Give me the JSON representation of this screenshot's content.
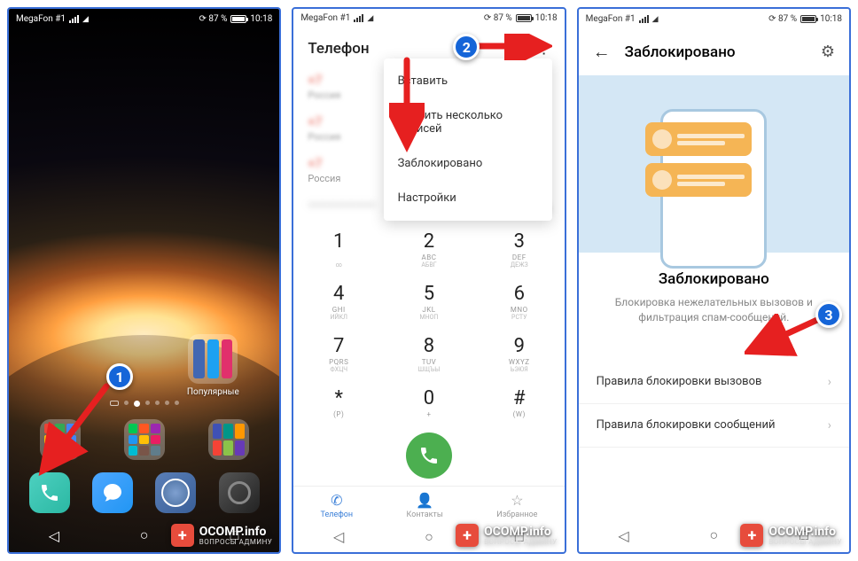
{
  "status": {
    "carrier": "MegaFon #1",
    "battery": "87 %",
    "time": "10:18"
  },
  "screen1": {
    "folder_label": "Популярные",
    "badge": "1"
  },
  "screen2": {
    "title": "Телефон",
    "badge": "2",
    "calls": [
      {
        "num": "+7",
        "sub": "Россия"
      },
      {
        "num": "+7",
        "sub": "Россия"
      },
      {
        "num": "+7",
        "sub": "Россия"
      }
    ],
    "recent_date": "02.07",
    "menu": [
      "Вставить",
      "Удалить несколько записей",
      "Заблокировано",
      "Настройки"
    ],
    "keys": [
      {
        "n": "1",
        "s1": "",
        "s2": "∞"
      },
      {
        "n": "2",
        "s1": "ABC",
        "s2": "АБВГ"
      },
      {
        "n": "3",
        "s1": "DEF",
        "s2": "ДЕЖЗ"
      },
      {
        "n": "4",
        "s1": "GHI",
        "s2": "ИЙКЛ"
      },
      {
        "n": "5",
        "s1": "JKL",
        "s2": "МНОП"
      },
      {
        "n": "6",
        "s1": "MNO",
        "s2": "РСТУ"
      },
      {
        "n": "7",
        "s1": "PQRS",
        "s2": "ФХЦЧ"
      },
      {
        "n": "8",
        "s1": "TUV",
        "s2": "ШЩЪЫ"
      },
      {
        "n": "9",
        "s1": "WXYZ",
        "s2": "ЬЭЮЯ"
      },
      {
        "n": "*",
        "s1": "(P)",
        "s2": ""
      },
      {
        "n": "0",
        "s1": "+",
        "s2": ""
      },
      {
        "n": "#",
        "s1": "(W)",
        "s2": ""
      }
    ],
    "tabs": {
      "phone": "Телефон",
      "contacts": "Контакты",
      "fav": "Избранное"
    }
  },
  "screen3": {
    "title": "Заблокировано",
    "badge": "3",
    "heading": "Заблокировано",
    "desc": "Блокировка нежелательных вызовов и фильтрация спам-сообщений.",
    "rule_calls": "Правила блокировки вызовов",
    "rule_msgs": "Правила блокировки сообщений"
  },
  "watermark": {
    "main": "OCOMP.info",
    "sub": "ВОПРОСЫ АДМИНУ"
  }
}
